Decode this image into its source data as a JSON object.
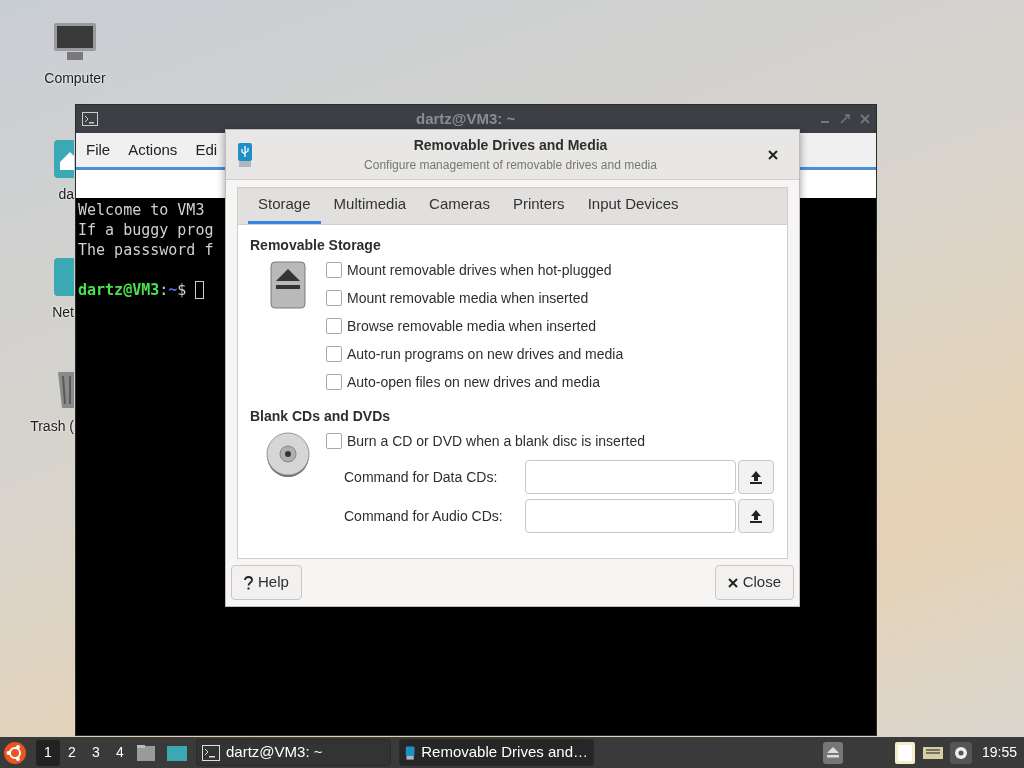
{
  "desktop_icons": [
    {
      "label": "Computer",
      "kind": "computer"
    },
    {
      "label": "da",
      "kind": "home"
    },
    {
      "label": "Net",
      "kind": "folder"
    },
    {
      "label": "Trash (",
      "kind": "trash"
    }
  ],
  "terminal": {
    "title": "dartz@VM3: ~",
    "menu": [
      "File",
      "Actions",
      "Edi"
    ],
    "lines": [
      "Welcome to VM3",
      "If a buggy prog",
      "The passsword f"
    ],
    "prompt": {
      "user": "dartz@VM3",
      "separator": ":",
      "path": "~",
      "symbol": "$"
    }
  },
  "dialog": {
    "title": "Removable Drives and Media",
    "subtitle": "Configure management of removable drives and media",
    "tabs": [
      {
        "label": "Storage",
        "selected": true
      },
      {
        "label": "Multimedia",
        "selected": false
      },
      {
        "label": "Cameras",
        "selected": false
      },
      {
        "label": "Printers",
        "selected": false
      },
      {
        "label": "Input Devices",
        "selected": false
      }
    ],
    "sections": [
      {
        "heading": "Removable Storage",
        "kind": "eject",
        "options": [
          {
            "label": "Mount removable drives when hot-plugged",
            "checked": false
          },
          {
            "label": "Mount removable media when inserted",
            "checked": false
          },
          {
            "label": "Browse removable media when inserted",
            "checked": false
          },
          {
            "label": "Auto-run programs on new drives and media",
            "checked": false
          },
          {
            "label": "Auto-open files on new drives and media",
            "checked": false
          }
        ]
      },
      {
        "heading": "Blank CDs and DVDs",
        "kind": "disc",
        "options": [
          {
            "label": "Burn a CD or DVD when a blank disc is inserted",
            "checked": false
          }
        ],
        "fields": [
          {
            "label": "Command for Data CDs:"
          },
          {
            "label": "Command for Audio CDs:"
          }
        ]
      }
    ],
    "buttons": [
      {
        "label": "Help",
        "kind": "help"
      },
      {
        "label": "Close",
        "kind": "close"
      }
    ]
  },
  "taskbar": {
    "workspaces": [
      {
        "label": "1",
        "selected": true
      },
      {
        "label": "2",
        "selected": false
      },
      {
        "label": "3",
        "selected": false
      },
      {
        "label": "4",
        "selected": false
      }
    ],
    "tasks": [
      {
        "label": "dartz@VM3: ~",
        "kind": "terminal",
        "selected": false
      },
      {
        "label": "Removable Drives and…",
        "kind": "drive",
        "selected": true
      }
    ],
    "clock": "19:55"
  }
}
